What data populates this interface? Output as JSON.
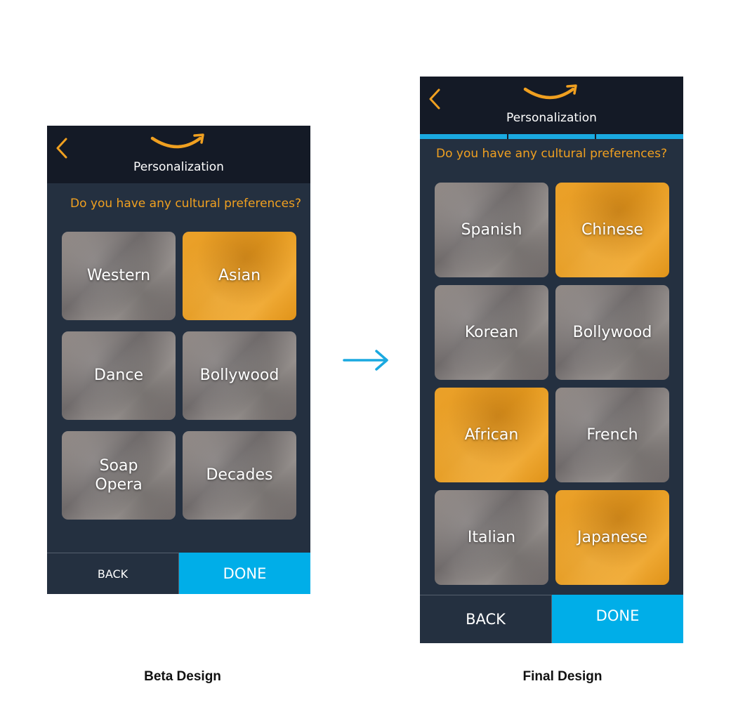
{
  "colors": {
    "accent_orange": "#f0a020",
    "done_blue": "#00aee8",
    "background_dark": "#243040",
    "topbar": "#141a26"
  },
  "beta": {
    "title": "Personalization",
    "question": "Do you have any cultural preferences?",
    "tiles": [
      {
        "label": "Western",
        "style": "gray"
      },
      {
        "label": "Asian",
        "style": "orange"
      },
      {
        "label": "Dance",
        "style": "gray"
      },
      {
        "label": "Bollywood",
        "style": "gray"
      },
      {
        "label": "Soap\nOpera",
        "style": "gray"
      },
      {
        "label": "Decades",
        "style": "gray"
      }
    ],
    "back_label": "BACK",
    "done_label": "DONE",
    "caption": "Beta Design"
  },
  "final": {
    "title": "Personalization",
    "question": "Do you have any cultural preferences?",
    "progress_segments": 3,
    "tiles": [
      {
        "label": "Spanish",
        "style": "gray"
      },
      {
        "label": "Chinese",
        "style": "orange"
      },
      {
        "label": "Korean",
        "style": "gray"
      },
      {
        "label": "Bollywood",
        "style": "gray"
      },
      {
        "label": "African",
        "style": "orange"
      },
      {
        "label": "French",
        "style": "gray"
      },
      {
        "label": "Italian",
        "style": "gray"
      },
      {
        "label": "Japanese",
        "style": "orange"
      }
    ],
    "back_label": "BACK",
    "done_label": "DONE",
    "caption": "Final Design"
  },
  "icons": {
    "back": "chevron-left-icon",
    "logo": "smile-logo-icon",
    "transition": "arrow-right-icon"
  }
}
